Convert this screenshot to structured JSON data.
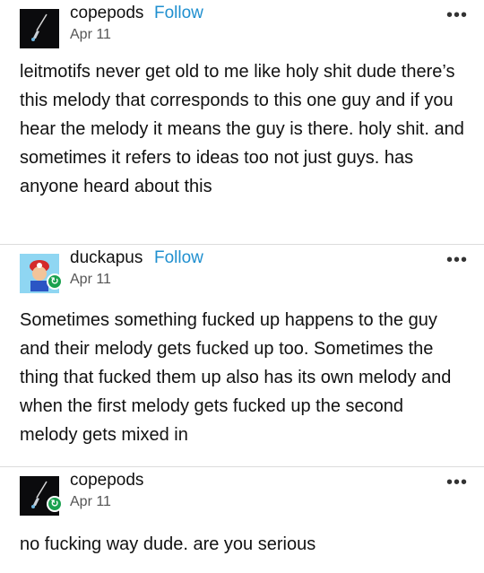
{
  "posts": [
    {
      "username": "copepods",
      "follow_label": "Follow",
      "date": "Apr 11",
      "more_label": "•••",
      "avatar_icon": "fishing-lure-icon",
      "text": "leitmotifs never get old to me like holy shit dude there’s this melody that corresponds to this one guy and if you hear the melody it means the guy is there. holy shit. and sometimes it refers to ideas too not just guys. has anyone heard about this"
    },
    {
      "username": "duckapus",
      "follow_label": "Follow",
      "date": "Apr 11",
      "more_label": "•••",
      "avatar_icon": "mario-avatar-icon",
      "reblog_icon": "reblog-icon",
      "text": "Sometimes something fucked up happens to the guy and their melody gets fucked up too. Sometimes the thing that fucked them up also has its own melody and when the first melody gets fucked up the second melody gets mixed in"
    },
    {
      "username": "copepods",
      "date": "Apr 11",
      "more_label": "•••",
      "avatar_icon": "fishing-lure-icon",
      "reblog_icon": "reblog-icon",
      "text": "no fucking way dude. are you serious"
    }
  ],
  "colors": {
    "follow": "#1f8fcf",
    "reblog_badge": "#1aa14f",
    "divider": "#dcdcdc"
  }
}
